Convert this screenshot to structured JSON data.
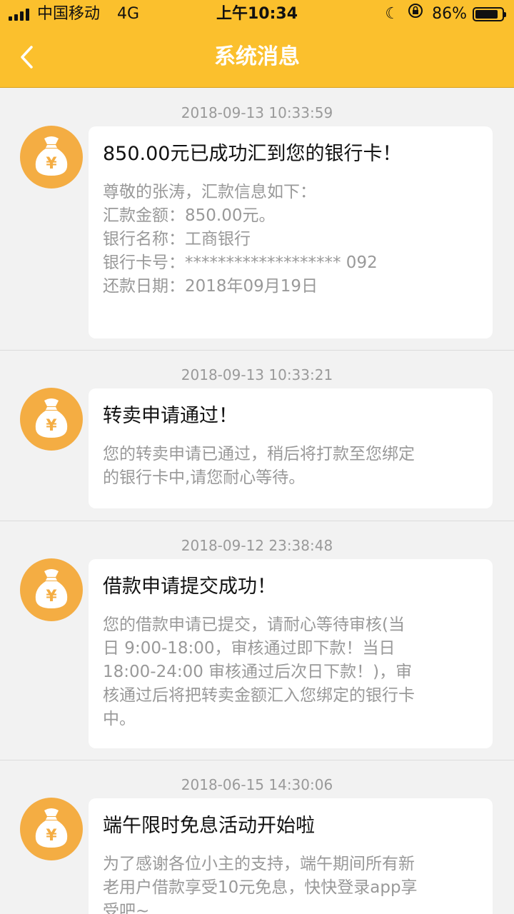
{
  "status_bar": {
    "carrier": "中国移动",
    "network": "4G",
    "time": "上午10:34",
    "battery_pct": "86%",
    "battery_level": 0.86
  },
  "nav": {
    "back_icon": "chevron-left-icon",
    "title": "系统消息"
  },
  "colors": {
    "header": "#fbc02d",
    "avatar": "#f4ad43",
    "page_bg": "#f2f2f2"
  },
  "messages": [
    {
      "time": "2018-09-13 10:33:59",
      "title": "850.00元已成功汇到您的银行卡！",
      "lines": [
        "尊敬的张涛，汇款信息如下：",
        "汇款金额：850.00元。",
        "银行名称：工商银行",
        "银行卡号：******************* 092",
        "还款日期：2018年09月19日"
      ]
    },
    {
      "time": "2018-09-13 10:33:21",
      "title": "转卖申请通过！",
      "lines": [
        "您的转卖申请已通过，稍后将打款至您绑定",
        "的银行卡中,请您耐心等待。"
      ]
    },
    {
      "time": "2018-09-12 23:38:48",
      "title": "借款申请提交成功！",
      "lines": [
        "您的借款申请已提交，请耐心等待审核(当",
        "日 9:00-18:00，审核通过即下款！当日",
        "18:00-24:00 审核通过后次日下款！)，审",
        "核通过后将把转卖金额汇入您绑定的银行卡",
        "中。"
      ]
    },
    {
      "time": "2018-06-15 14:30:06",
      "title": "端午限时免息活动开始啦",
      "lines": [
        "为了感谢各位小主的支持，端午期间所有新",
        "老用户借款享受10元免息，快快登录app享",
        "受吧~"
      ]
    }
  ]
}
